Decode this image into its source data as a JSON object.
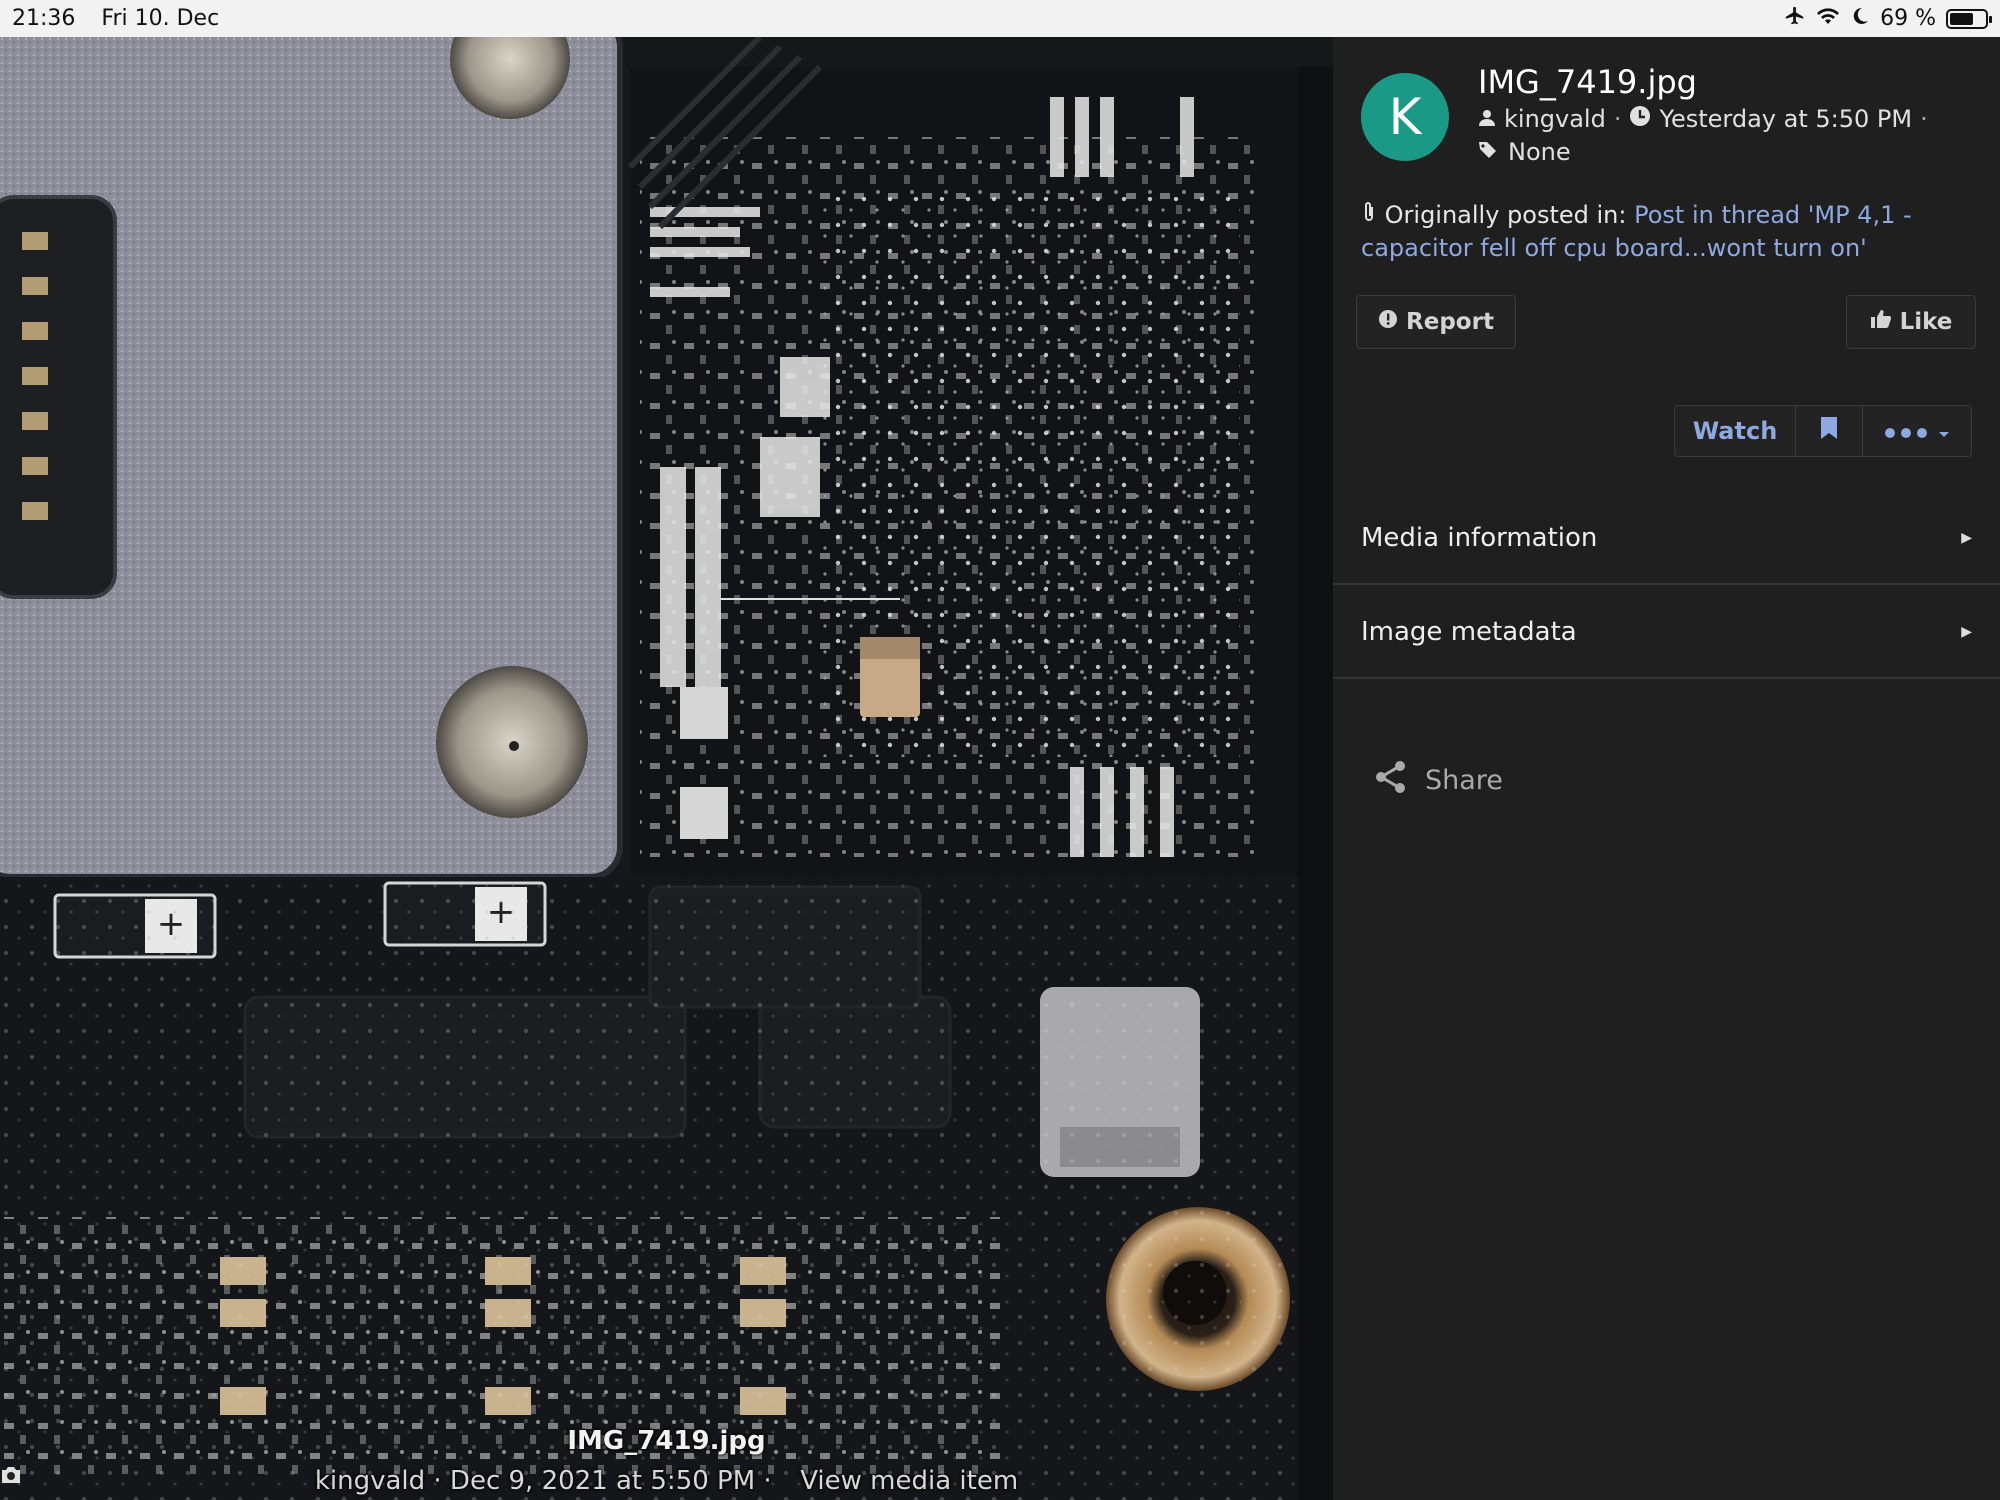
{
  "status_bar": {
    "time": "21:36",
    "date": "Fri 10. Dec",
    "battery": "69 %",
    "battery_level": 0.69,
    "icons": [
      "airplane-icon",
      "wifi-icon",
      "moon-icon",
      "battery-icon"
    ]
  },
  "photo": {
    "title": "IMG_7419.jpg",
    "author": "kingvald",
    "separator": "·",
    "date": "Dec 9, 2021 at 5:50 PM",
    "view_link": "View media item"
  },
  "panel": {
    "avatar_letter": "K",
    "avatar_color": "#1a9a86",
    "title": "IMG_7419.jpg",
    "user": "kingvald",
    "separator": "·",
    "time": "Yesterday at 5:50 PM",
    "tags": "None",
    "posted_label": "Originally posted in:",
    "posted_link": "Post in thread 'MP 4,1 - capacitor fell off cpu board...wont turn on'",
    "report_label": "Report",
    "like_label": "Like",
    "watch_label": "Watch",
    "sections": {
      "media_info": "Media information",
      "image_metadata": "Image metadata"
    },
    "share_label": "Share",
    "link_color": "#8ea8e0"
  }
}
